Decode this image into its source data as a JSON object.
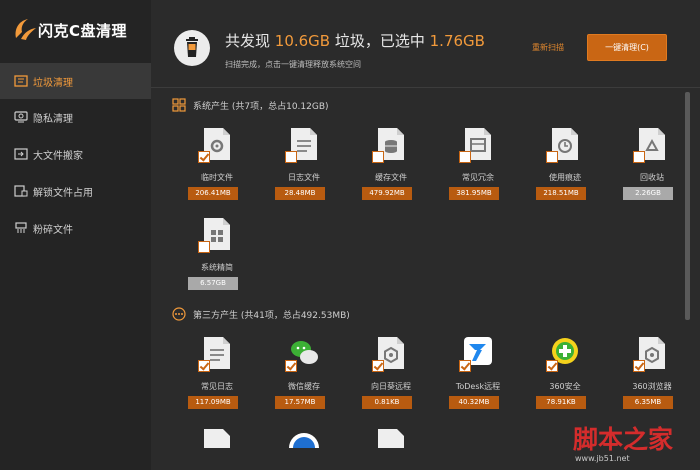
{
  "app": {
    "title": "闪克C盘清理",
    "accent": "#f29a3b",
    "button_color": "#c96614"
  },
  "window_controls": {
    "user_icon": "user-icon",
    "menu_icon": "menu-icon",
    "minimize_icon": "minimize-icon",
    "close_icon": "close-icon"
  },
  "sidebar": {
    "items": [
      {
        "label": "垃圾清理",
        "icon": "broom-icon",
        "active": true
      },
      {
        "label": "隐私清理",
        "icon": "privacy-icon",
        "active": false
      },
      {
        "label": "大文件搬家",
        "icon": "move-icon",
        "active": false
      },
      {
        "label": "解锁文件占用",
        "icon": "unlock-icon",
        "active": false
      },
      {
        "label": "粉碎文件",
        "icon": "shred-icon",
        "active": false
      }
    ]
  },
  "header": {
    "headline_prefix": "共发现 ",
    "found_size": "10.6GB",
    "headline_mid": " 垃圾，已选中 ",
    "selected_size": "1.76GB",
    "subline": "扫描完成，点击一键清理释放系统空间",
    "rescan_label": "重新扫描",
    "clean_label": "一键清理(C)"
  },
  "sections": {
    "system": {
      "title": "系统产生 (共7项，总占10.12GB)",
      "items": [
        {
          "label": "临时文件",
          "size": "206.41MB",
          "checked": true,
          "icon": "gear-file-icon"
        },
        {
          "label": "日志文件",
          "size": "28.48MB",
          "checked": false,
          "icon": "log-file-icon"
        },
        {
          "label": "缓存文件",
          "size": "479.92MB",
          "checked": false,
          "icon": "cache-file-icon"
        },
        {
          "label": "常见冗余",
          "size": "381.95MB",
          "checked": false,
          "icon": "redundant-file-icon"
        },
        {
          "label": "使用痕迹",
          "size": "218.51MB",
          "checked": false,
          "icon": "clock-file-icon"
        },
        {
          "label": "回收站",
          "size": "2.26GB",
          "checked": false,
          "icon": "recycle-bin-icon"
        },
        {
          "label": "系统精简",
          "size": "6.57GB",
          "checked": false,
          "icon": "windows-file-icon"
        }
      ]
    },
    "thirdparty": {
      "title": "第三方产生 (共41项，总占492.53MB)",
      "items": [
        {
          "label": "常见日志",
          "size": "117.09MB",
          "checked": true,
          "icon": "log-file-icon"
        },
        {
          "label": "微信缓存",
          "size": "17.57MB",
          "checked": true,
          "icon": "wechat-icon"
        },
        {
          "label": "向日葵远程",
          "size": "0.81KB",
          "checked": true,
          "icon": "hex-file-icon"
        },
        {
          "label": "ToDesk远程",
          "size": "40.32MB",
          "checked": true,
          "icon": "todesk-icon"
        },
        {
          "label": "360安全",
          "size": "78.91KB",
          "checked": true,
          "icon": "360-safe-icon"
        },
        {
          "label": "360浏览器",
          "size": "6.35MB",
          "checked": true,
          "icon": "hex-file-icon"
        }
      ]
    }
  },
  "watermark": {
    "text": "脚本之家",
    "url": "www.jb51.net"
  }
}
